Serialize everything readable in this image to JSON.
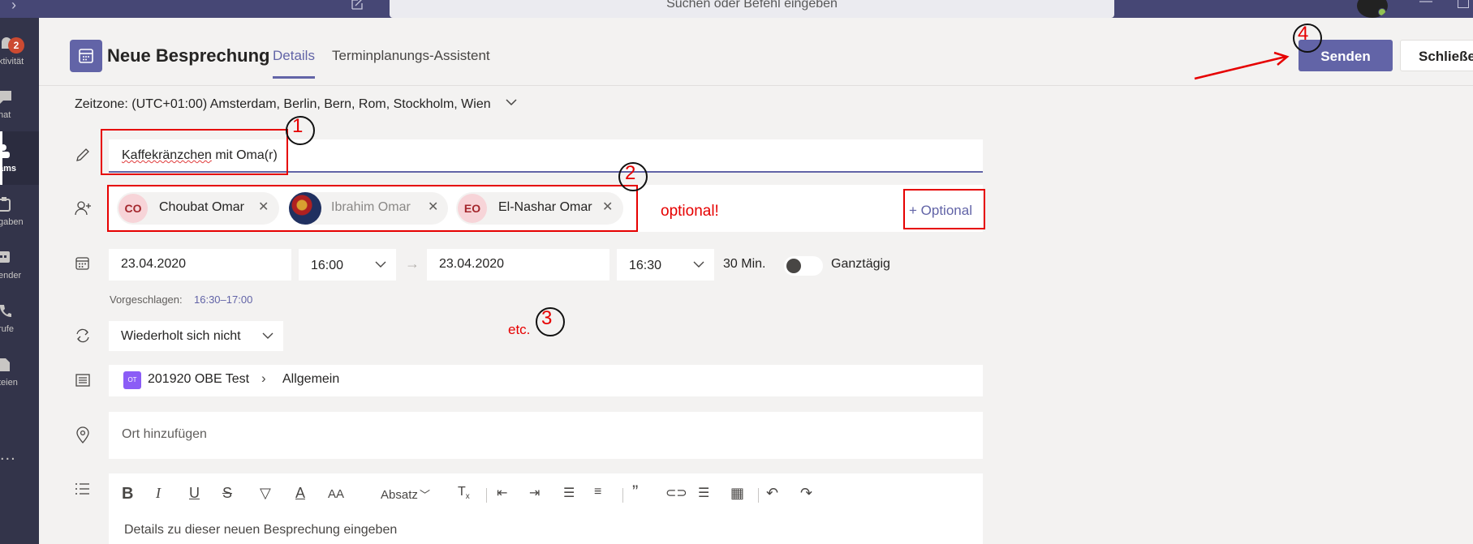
{
  "search": {
    "placeholder": "Suchen oder Befehl eingeben"
  },
  "rail": {
    "items": [
      {
        "label": "ktivität",
        "icon": "bell-icon",
        "badge": "2"
      },
      {
        "label": "hat",
        "icon": "chat-icon"
      },
      {
        "label": "ams",
        "icon": "teams-icon"
      },
      {
        "label": "gaben",
        "icon": "assignments-icon"
      },
      {
        "label": "ender",
        "icon": "calendar-icon"
      },
      {
        "label": "rufe",
        "icon": "phone-icon"
      },
      {
        "label": "teien",
        "icon": "files-icon"
      }
    ],
    "more": "..."
  },
  "header": {
    "title": "Neue Besprechung",
    "tabs": [
      "Details",
      "Terminplanungs-Assistent"
    ],
    "send_label": "Senden",
    "close_label": "Schließen"
  },
  "timezone": "Zeitzone: (UTC+01:00) Amsterdam, Berlin, Bern, Rom, Stockholm, Wien",
  "meeting": {
    "title_spellcheck": "Kaffekränzchen",
    "title_rest": " mit Oma(r)",
    "attendees": [
      {
        "initials": "CO",
        "name": "Choubat Omar"
      },
      {
        "initials": "",
        "name": "Ibrahim Omar"
      },
      {
        "initials": "EO",
        "name": "El-Nashar Omar"
      }
    ],
    "optional_link": "+ Optional",
    "start_date": "23.04.2020",
    "start_time": "16:00",
    "end_date": "23.04.2020",
    "end_time": "16:30",
    "duration": "30 Min.",
    "all_day_label": "Ganztägig",
    "all_day": false,
    "suggested_label": "Vorgeschlagen:",
    "suggested_time": "16:30–17:00",
    "repeat": "Wiederholt sich nicht",
    "team_icon_text": "OT",
    "team": "201920 OBE Test",
    "channel": "Allgemein",
    "location_placeholder": "Ort hinzufügen",
    "details_placeholder": "Details zu dieser neuen Besprechung eingeben"
  },
  "editor_toolbar": {
    "paragraph_label": "Absatz"
  },
  "annotations": {
    "note_optional": "optional!",
    "note_etc": "etc.",
    "numbers": [
      "1",
      "2",
      "3",
      "4"
    ],
    "color": "#e60000"
  },
  "colors": {
    "accent": "#6264a7",
    "rail": "#33344a",
    "titlebar": "#464775"
  }
}
